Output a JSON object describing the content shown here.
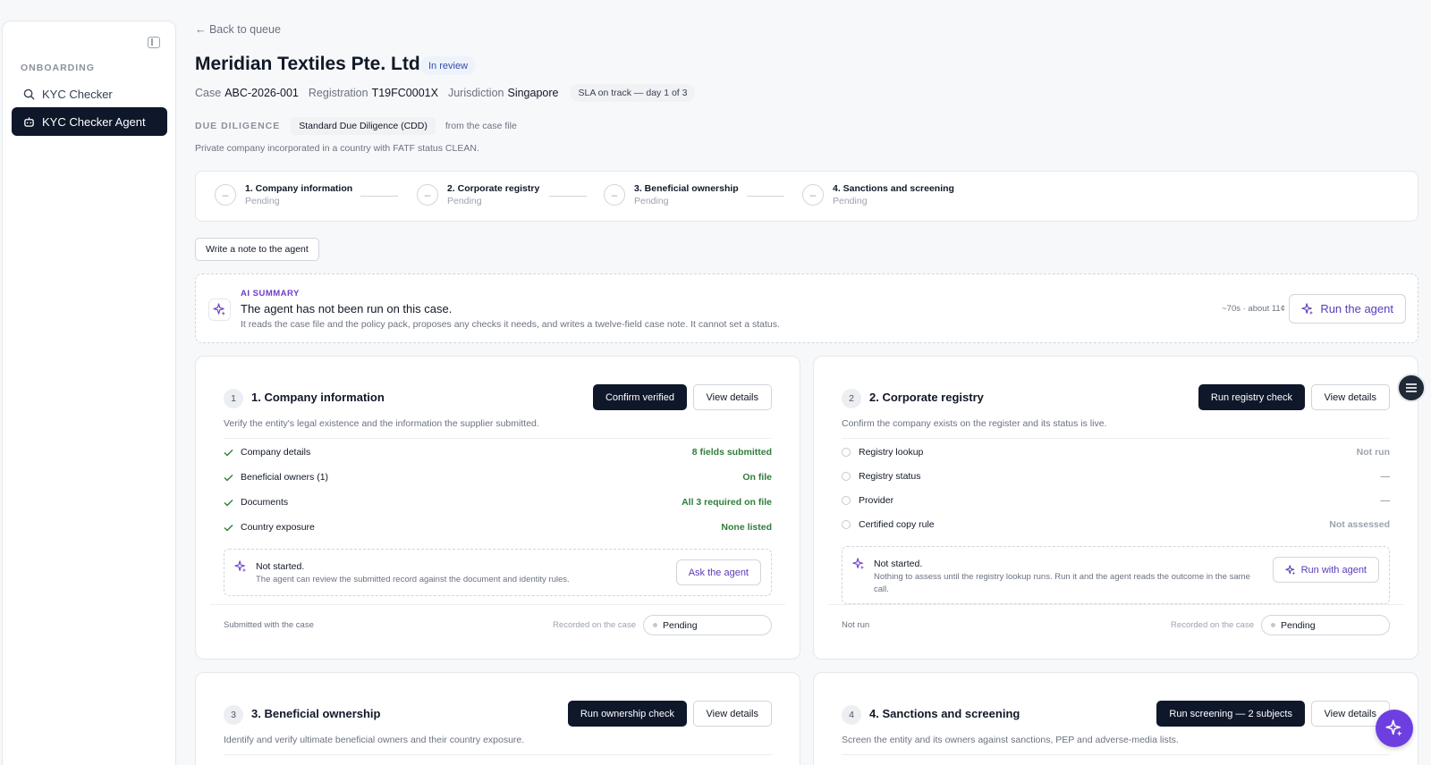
{
  "sidebar": {
    "section": "ONBOARDING",
    "items": [
      {
        "label": "KYC Checker",
        "icon": "search-icon"
      },
      {
        "label": "KYC Checker Agent",
        "icon": "robot-icon"
      }
    ]
  },
  "header": {
    "back": "← Back to queue",
    "title": "Meridian Textiles Pte. Ltd.",
    "status_badge": "In review",
    "case_label": "Case",
    "case_value": "ABC-2026-001",
    "registration_label": "Registration",
    "registration_value": "T19FC0001X",
    "jurisdiction_label": "Jurisdiction",
    "jurisdiction_value": "Singapore",
    "sla": "SLA on track — day 1 of 3"
  },
  "due_diligence": {
    "label": "DUE DILIGENCE",
    "value": "Standard Due Diligence (CDD)",
    "source": "from the case file",
    "description": "Private company incorporated in a country with FATF status CLEAN."
  },
  "steps": [
    {
      "title": "1. Company information",
      "status": "Pending",
      "symbol": "–"
    },
    {
      "title": "2. Corporate registry",
      "status": "Pending",
      "symbol": "–"
    },
    {
      "title": "3. Beneficial ownership",
      "status": "Pending",
      "symbol": "–"
    },
    {
      "title": "4. Sanctions and screening",
      "status": "Pending",
      "symbol": "–"
    }
  ],
  "note_button": "Write a note to the agent",
  "ai_summary": {
    "label": "AI SUMMARY",
    "headline": "The agent has not been run on this case.",
    "description": "It reads the case file and the policy pack, proposes any checks it needs, and writes a twelve-field case note. It cannot set a status.",
    "cost": "~70s · about 11¢",
    "run_button": "Run the agent"
  },
  "cards": {
    "company": {
      "num": "1",
      "title": "1. Company information",
      "primary": "Confirm verified",
      "secondary": "View details",
      "description": "Verify the entity's legal existence and the information the supplier submitted.",
      "rows": [
        {
          "label": "Company details",
          "value": "8 fields submitted"
        },
        {
          "label": "Beneficial owners (1)",
          "value": "On file"
        },
        {
          "label": "Documents",
          "value": "All 3 required on file"
        },
        {
          "label": "Country exposure",
          "value": "None listed"
        }
      ],
      "agent_head": "Not started.",
      "agent_desc": "The agent can review the submitted record against the document and identity rules.",
      "agent_button": "Ask the agent",
      "footer_left": "Submitted with the case",
      "footer_recorded": "Recorded on the case",
      "status": "Pending"
    },
    "registry": {
      "num": "2",
      "title": "2. Corporate registry",
      "primary": "Run registry check",
      "secondary": "View details",
      "description": "Confirm the company exists on the register and its status is live.",
      "rows": [
        {
          "label": "Registry lookup",
          "value": "Not run"
        },
        {
          "label": "Registry status",
          "value": "—"
        },
        {
          "label": "Provider",
          "value": "—"
        },
        {
          "label": "Certified copy rule",
          "value": "Not assessed"
        }
      ],
      "agent_head": "Not started.",
      "agent_desc": "Nothing to assess until the registry lookup runs. Run it and the agent reads the outcome in the same call.",
      "agent_button": "Run with agent",
      "footer_left": "Not run",
      "footer_recorded": "Recorded on the case",
      "status": "Pending"
    },
    "ownership": {
      "num": "3",
      "title": "3. Beneficial ownership",
      "primary": "Run ownership check",
      "secondary": "View details",
      "description": "Identify and verify ultimate beneficial owners and their country exposure."
    },
    "sanctions": {
      "num": "4",
      "title": "4. Sanctions and screening",
      "primary": "Run screening — 2 subjects",
      "secondary": "View details",
      "description": "Screen the entity and its owners against sanctions, PEP and adverse-media lists."
    }
  },
  "colors": {
    "accent_dark": "#0f172a",
    "ai_purple": "#6d3fe0",
    "success_green": "#2f7d3b"
  }
}
